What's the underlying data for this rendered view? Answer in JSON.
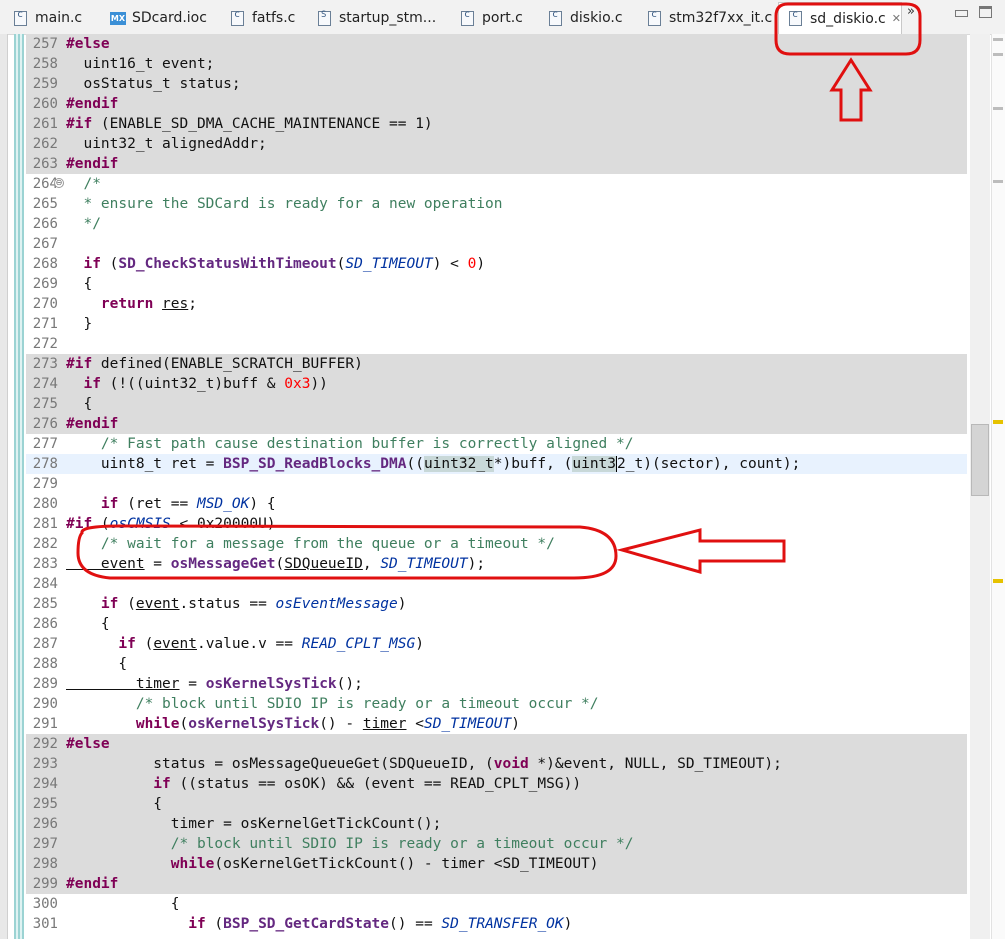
{
  "tabs": [
    {
      "label": "main.c",
      "icon": "c-file-icon"
    },
    {
      "label": "SDcard.ioc",
      "icon": "mx-file-icon",
      "badge": "MX"
    },
    {
      "label": "fatfs.c",
      "icon": "c-file-icon"
    },
    {
      "label": "startup_stm...",
      "icon": "asm-file-icon"
    },
    {
      "label": "port.c",
      "icon": "c-file-icon"
    },
    {
      "label": "diskio.c",
      "icon": "c-file-icon"
    },
    {
      "label": "stm32f7xx_it.c",
      "icon": "c-file-icon"
    },
    {
      "label": "sd_diskio.c",
      "icon": "c-file-icon",
      "active": true
    }
  ],
  "tab_overflow": "»",
  "close_glyph": "✕",
  "fold_glyph": "⊖",
  "colors": {
    "annotation": "#e01010",
    "inactive_code_bg": "#dcdcdc",
    "current_line_bg": "#e8f2fe",
    "keyword": "#7f0055",
    "comment": "#3f7f5f",
    "macro": "#0032a0"
  },
  "lines": [
    {
      "n": "257",
      "style": "inactive",
      "tokens": [
        [
          "kw",
          "#else"
        ]
      ]
    },
    {
      "n": "258",
      "style": "inactive",
      "tokens": [
        [
          "",
          "  uint16_t event;"
        ]
      ]
    },
    {
      "n": "259",
      "style": "inactive",
      "tokens": [
        [
          "",
          "  osStatus_t status;"
        ]
      ]
    },
    {
      "n": "260",
      "style": "inactive",
      "tokens": [
        [
          "kw",
          "#endif"
        ]
      ]
    },
    {
      "n": "261",
      "style": "inactive",
      "tokens": [
        [
          "kw",
          "#if"
        ],
        [
          "",
          " (ENABLE_SD_DMA_CACHE_MAINTENANCE == 1)"
        ]
      ]
    },
    {
      "n": "262",
      "style": "inactive",
      "tokens": [
        [
          "",
          "  uint32_t alignedAddr;"
        ]
      ]
    },
    {
      "n": "263",
      "style": "inactive",
      "tokens": [
        [
          "kw",
          "#endif"
        ]
      ]
    },
    {
      "n": "264",
      "fold": true,
      "tokens": [
        [
          "cm",
          "  /*"
        ]
      ]
    },
    {
      "n": "265",
      "tokens": [
        [
          "cm",
          "  * ensure the SDCard is ready for a new operation"
        ]
      ]
    },
    {
      "n": "266",
      "tokens": [
        [
          "cm",
          "  */"
        ]
      ]
    },
    {
      "n": "267",
      "tokens": []
    },
    {
      "n": "268",
      "tokens": [
        [
          "kw",
          "  if"
        ],
        [
          "",
          " ("
        ],
        [
          "fn",
          "SD_CheckStatusWithTimeout"
        ],
        [
          "",
          "("
        ],
        [
          "mac",
          "SD_TIMEOUT"
        ],
        [
          "",
          ") < "
        ],
        [
          "num",
          "0"
        ],
        [
          "",
          ")"
        ]
      ]
    },
    {
      "n": "269",
      "tokens": [
        [
          "",
          "  {"
        ]
      ]
    },
    {
      "n": "270",
      "tokens": [
        [
          "kw",
          "    return"
        ],
        [
          "",
          " "
        ],
        [
          "u",
          "res"
        ],
        [
          "",
          ";"
        ]
      ]
    },
    {
      "n": "271",
      "tokens": [
        [
          "",
          "  }"
        ]
      ]
    },
    {
      "n": "272",
      "tokens": []
    },
    {
      "n": "273",
      "style": "inactive",
      "tokens": [
        [
          "kw",
          "#if"
        ],
        [
          "",
          " defined(ENABLE_SCRATCH_BUFFER)"
        ]
      ]
    },
    {
      "n": "274",
      "style": "inactive",
      "tokens": [
        [
          "kw",
          "  if"
        ],
        [
          "",
          " (!((uint32_t)buff & "
        ],
        [
          "num",
          "0x3"
        ],
        [
          "",
          "))"
        ]
      ]
    },
    {
      "n": "275",
      "style": "inactive",
      "tokens": [
        [
          "",
          "  {"
        ]
      ]
    },
    {
      "n": "276",
      "style": "inactive",
      "tokens": [
        [
          "kw",
          "#endif"
        ]
      ]
    },
    {
      "n": "277",
      "tokens": [
        [
          "cm",
          "    /* Fast path cause destination buffer is correctly aligned */"
        ]
      ]
    },
    {
      "n": "278",
      "style": "current",
      "tokens": [
        [
          "",
          "    uint8_t ret = "
        ],
        [
          "fn",
          "BSP_SD_ReadBlocks_DMA"
        ],
        [
          "",
          "(("
        ],
        [
          "occ",
          "uint32_t"
        ],
        [
          "",
          "*)buff, ("
        ],
        [
          "occ",
          "uint3"
        ],
        [
          "cursor",
          "2_t"
        ],
        [
          "",
          ")(sector), count);"
        ]
      ]
    },
    {
      "n": "279",
      "tokens": []
    },
    {
      "n": "280",
      "tokens": [
        [
          "kw",
          "    if"
        ],
        [
          "",
          " (ret == "
        ],
        [
          "mac",
          "MSD_OK"
        ],
        [
          "",
          ") {"
        ]
      ]
    },
    {
      "n": "281",
      "tokens": [
        [
          "kw",
          "#if"
        ],
        [
          "",
          " ("
        ],
        [
          "mac",
          "osCMSIS"
        ],
        [
          "",
          " < 0x20000U)"
        ]
      ]
    },
    {
      "n": "282",
      "tokens": [
        [
          "cm",
          "    /* wait for a message from the queue or a timeout */"
        ]
      ]
    },
    {
      "n": "283",
      "tokens": [
        [
          "u",
          "    event"
        ],
        [
          "",
          " = "
        ],
        [
          "fn",
          "osMessageGet"
        ],
        [
          "",
          "("
        ],
        [
          "u",
          "SDQueueID"
        ],
        [
          "",
          ", "
        ],
        [
          "mac",
          "SD_TIMEOUT"
        ],
        [
          "",
          ");"
        ]
      ]
    },
    {
      "n": "284",
      "tokens": []
    },
    {
      "n": "285",
      "tokens": [
        [
          "kw",
          "    if"
        ],
        [
          "",
          " ("
        ],
        [
          "u",
          "event"
        ],
        [
          "",
          ".status == "
        ],
        [
          "mac",
          "osEventMessage"
        ],
        [
          "",
          ")"
        ]
      ]
    },
    {
      "n": "286",
      "tokens": [
        [
          "",
          "    {"
        ]
      ]
    },
    {
      "n": "287",
      "tokens": [
        [
          "kw",
          "      if"
        ],
        [
          "",
          " ("
        ],
        [
          "u",
          "event"
        ],
        [
          "",
          ".value.v == "
        ],
        [
          "mac",
          "READ_CPLT_MSG"
        ],
        [
          "",
          ")"
        ]
      ]
    },
    {
      "n": "288",
      "tokens": [
        [
          "",
          "      {"
        ]
      ]
    },
    {
      "n": "289",
      "tokens": [
        [
          "u",
          "        timer"
        ],
        [
          "",
          " = "
        ],
        [
          "fn",
          "osKernelSysTick"
        ],
        [
          "",
          "();"
        ]
      ]
    },
    {
      "n": "290",
      "tokens": [
        [
          "cm",
          "        /* block until SDIO IP is ready or a timeout occur */"
        ]
      ]
    },
    {
      "n": "291",
      "tokens": [
        [
          "kw",
          "        while"
        ],
        [
          "",
          "("
        ],
        [
          "fn",
          "osKernelSysTick"
        ],
        [
          "",
          "() - "
        ],
        [
          "u",
          "timer"
        ],
        [
          "",
          " <"
        ],
        [
          "mac",
          "SD_TIMEOUT"
        ],
        [
          "",
          ")"
        ]
      ]
    },
    {
      "n": "292",
      "style": "inactive",
      "tokens": [
        [
          "kw",
          "#else"
        ]
      ]
    },
    {
      "n": "293",
      "style": "inactive",
      "tokens": [
        [
          "",
          "          status = osMessageQueueGet(SDQueueID, ("
        ],
        [
          "kw",
          "void"
        ],
        [
          "",
          " *)&event, NULL, SD_TIMEOUT);"
        ]
      ]
    },
    {
      "n": "294",
      "style": "inactive",
      "tokens": [
        [
          "kw",
          "          if"
        ],
        [
          "",
          " ((status == osOK) && (event == READ_CPLT_MSG))"
        ]
      ]
    },
    {
      "n": "295",
      "style": "inactive",
      "tokens": [
        [
          "",
          "          {"
        ]
      ]
    },
    {
      "n": "296",
      "style": "inactive",
      "tokens": [
        [
          "",
          "            timer = osKernelGetTickCount();"
        ]
      ]
    },
    {
      "n": "297",
      "style": "inactive",
      "tokens": [
        [
          "cm",
          "            /* block until SDIO IP is ready or a timeout occur */"
        ]
      ]
    },
    {
      "n": "298",
      "style": "inactive",
      "tokens": [
        [
          "kw",
          "            while"
        ],
        [
          "",
          "(osKernelGetTickCount() - timer <SD_TIMEOUT)"
        ]
      ]
    },
    {
      "n": "299",
      "style": "inactive",
      "tokens": [
        [
          "kw",
          "#endif"
        ]
      ]
    },
    {
      "n": "300",
      "tokens": [
        [
          "",
          "            {"
        ]
      ]
    },
    {
      "n": "301",
      "tokens": [
        [
          "kw",
          "              if"
        ],
        [
          "",
          " ("
        ],
        [
          "fn",
          "BSP_SD_GetCardState"
        ],
        [
          "",
          "() == "
        ],
        [
          "mac",
          "SD_TRANSFER_OK"
        ],
        [
          "",
          ")"
        ]
      ]
    }
  ]
}
